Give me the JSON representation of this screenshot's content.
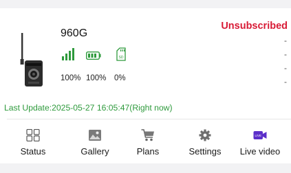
{
  "device": {
    "name": "960G",
    "subscription_status": "Unsubscribed",
    "signal_level": "100%",
    "battery_level": "100%",
    "sd_usage": "0%",
    "sd_label": "SD",
    "last_update": "Last Update:2025-05-27 16:05:47(Right now)",
    "dashes": [
      "-",
      "-",
      "-",
      "-"
    ]
  },
  "nav": {
    "items": [
      {
        "label": "Status",
        "icon": "grid-icon"
      },
      {
        "label": "Gallery",
        "icon": "image-icon"
      },
      {
        "label": "Plans",
        "icon": "cart-icon"
      },
      {
        "label": "Settings",
        "icon": "gear-icon"
      },
      {
        "label": "Live video",
        "icon": "live-video-icon",
        "badge": "LIVE"
      }
    ]
  },
  "colors": {
    "accent_green": "#2e9a3c",
    "status_red": "#d81b36",
    "live_purple": "#5b2fc9"
  }
}
